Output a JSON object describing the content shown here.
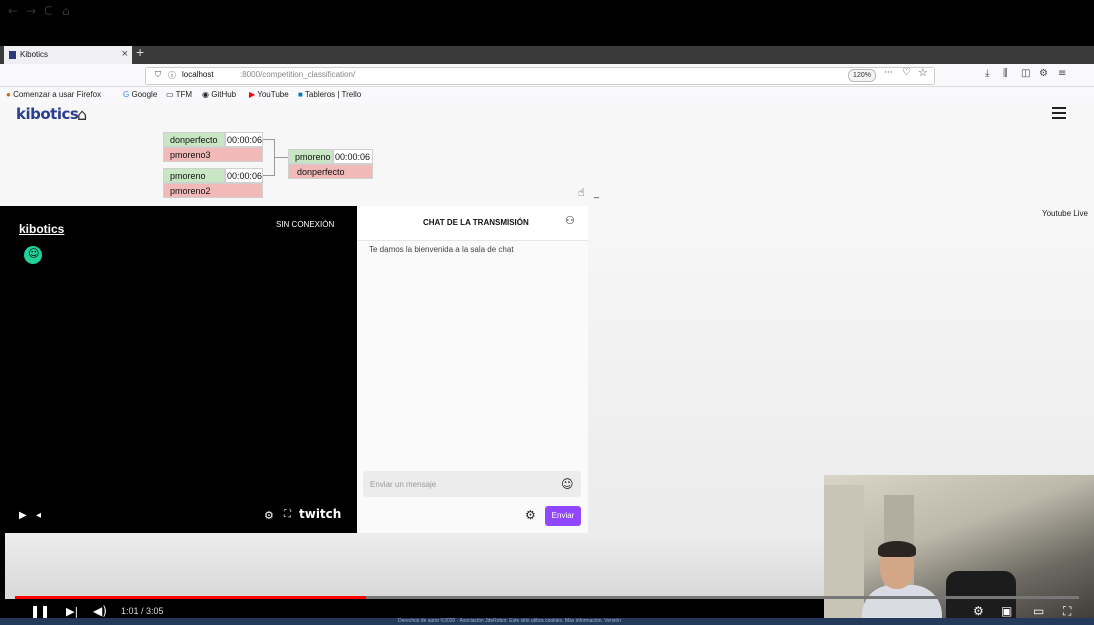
{
  "browser": {
    "tab_title": "Kibotics",
    "tab_close": "×",
    "new_tab": "+",
    "url_host": "localhost",
    "url_path": ":8000/competition_classification/",
    "zoom": "120%",
    "url_more": "···",
    "nav": {
      "back": "←",
      "forward": "→",
      "reload": "C",
      "home": "⌂"
    },
    "bookmarks": [
      "Comenzar a usar Firefox",
      "Google",
      "TFM",
      "GitHub",
      "YouTube",
      "Tableros | Trello"
    ]
  },
  "site": {
    "logo": "kibotics",
    "bracket": {
      "r1m1": {
        "p1": "donperfecto",
        "p1_time": "00:00:06",
        "p2": "pmoreno3"
      },
      "r1m2": {
        "p1": "pmoreno",
        "p1_time": "00:00:06",
        "p2": "pmoreno2"
      },
      "final": {
        "p1": "pmoreno",
        "p1_time": "00:00:06",
        "p2": "donperfecto"
      }
    },
    "youtube_live_label": "Youtube Live"
  },
  "twitch": {
    "channel": "kibotics",
    "status": "SIN CONEXIÓN",
    "brand": "twitch"
  },
  "chat": {
    "title": "CHAT DE LA TRANSMISIÓN",
    "welcome": "Te damos la bienvenida a la sala de chat",
    "input_placeholder": "Enviar un mensaje",
    "send_label": "Enviar"
  },
  "player": {
    "time": "1:01 / 3:05",
    "progress_fraction": 0.33
  },
  "footer": {
    "text": "Derechos de autor ©2020 · Asociación JdeRobot. Este sitio utiliza cookies. Más información. Versión"
  },
  "colors": {
    "win": "#c8e6c3",
    "lose": "#f2b9b9",
    "twitch_purple": "#9147ff",
    "logo_blue": "#2a3d8f",
    "youtube_red": "#ff0000"
  },
  "icons": [
    "shield-icon",
    "info-icon",
    "pocket-icon",
    "star-icon",
    "downloads-icon",
    "library-icon",
    "sidebar-icon",
    "extension-icon",
    "menu-icon",
    "home-icon",
    "hand-cursor-icon",
    "user-avatar-icon",
    "play-icon",
    "volume-icon",
    "gear-icon",
    "fullscreen-icon",
    "chat-users-icon",
    "emoji-icon",
    "pause-icon",
    "next-icon",
    "miniplayer-icon",
    "theater-icon"
  ]
}
